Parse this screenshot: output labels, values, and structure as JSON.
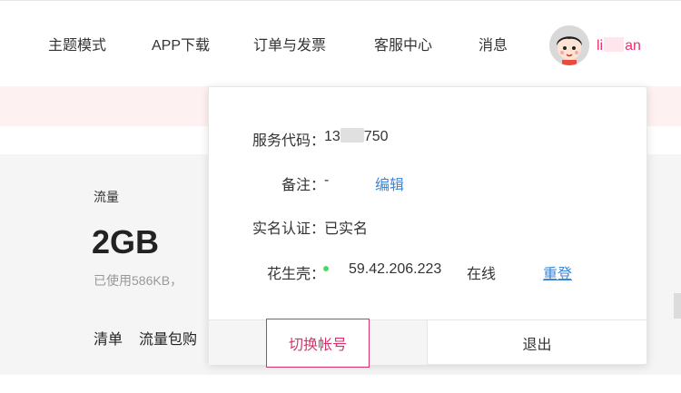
{
  "nav": {
    "items": [
      {
        "label": "主题模式"
      },
      {
        "label": "APP下载"
      },
      {
        "label": "订单与发票"
      },
      {
        "label": "客服中心"
      },
      {
        "label": "消息"
      }
    ],
    "user": {
      "name_start": "li",
      "name_end": "an"
    }
  },
  "main": {
    "flow_label": "流量",
    "flow_value": "2GB",
    "flow_used": "已使用586KB，",
    "tabs": [
      {
        "label": "清单"
      },
      {
        "label": "流量包购"
      }
    ]
  },
  "dropdown": {
    "service_code": {
      "label": "服务代码：",
      "value_start": "13",
      "value_end": "750"
    },
    "remark": {
      "label": "备注：",
      "value": "-",
      "edit": "编辑"
    },
    "realname": {
      "label": "实名认证：",
      "value": "已实名"
    },
    "hsk": {
      "label": "花生壳：",
      "ip": "59.42.206.223",
      "status": "在线",
      "relogin": "重登"
    },
    "switch_label": "切换帐号",
    "logout_label": "退出"
  },
  "colors": {
    "accent": "#d6336c",
    "link": "#3a86d8",
    "online": "#4cd964"
  }
}
